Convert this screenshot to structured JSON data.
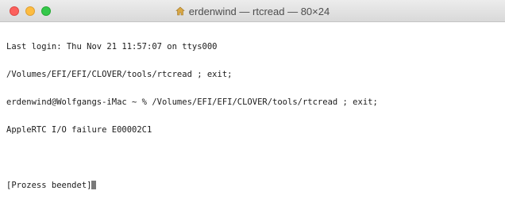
{
  "window": {
    "title": "erdenwind — rtcread — 80×24"
  },
  "terminal": {
    "lines": [
      "Last login: Thu Nov 21 11:57:07 on ttys000",
      "/Volumes/EFI/EFI/CLOVER/tools/rtcread ; exit;",
      "erdenwind@Wolfgangs-iMac ~ % /Volumes/EFI/EFI/CLOVER/tools/rtcread ; exit;",
      "AppleRTC I/O failure E00002C1",
      "",
      "[Prozess beendet]"
    ]
  },
  "icons": {
    "title_icon": "home-icon"
  }
}
